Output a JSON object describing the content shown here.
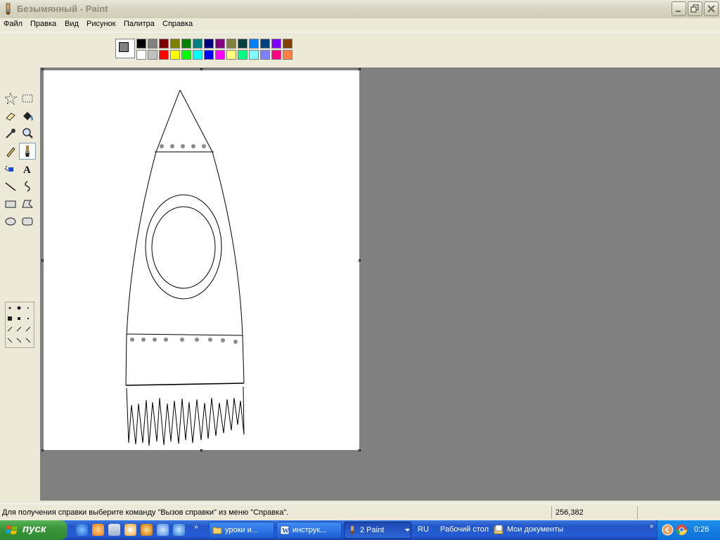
{
  "window": {
    "title": "Безымянный - Paint"
  },
  "menu": [
    "Файл",
    "Правка",
    "Вид",
    "Рисунок",
    "Палитра",
    "Справка"
  ],
  "palette": {
    "top": [
      "#000000",
      "#808080",
      "#800000",
      "#808000",
      "#008000",
      "#008080",
      "#000080",
      "#800080",
      "#808040",
      "#004040",
      "#0080ff",
      "#004080",
      "#8000ff",
      "#804000"
    ],
    "bottom": [
      "#ffffff",
      "#c0c0c0",
      "#ff0000",
      "#ffff00",
      "#00ff00",
      "#00ffff",
      "#0000ff",
      "#ff00ff",
      "#ffff80",
      "#00ff80",
      "#80ffff",
      "#8080ff",
      "#ff0080",
      "#ff8040"
    ],
    "foreground": "#808080",
    "background": "#ffffff"
  },
  "tools": [
    "free-form-select",
    "select",
    "eraser",
    "fill-with-color",
    "pick-color",
    "magnifier",
    "pencil",
    "brush",
    "airbrush",
    "text",
    "line",
    "curve",
    "rectangle",
    "polygon",
    "ellipse",
    "rounded-rectangle"
  ],
  "selected_tool": "brush",
  "status": {
    "help": "Для получения справки выберите команду \"Вызов справки\" из меню \"Справка\".",
    "coords": "256,382"
  },
  "taskbar": {
    "start_label": "пуск",
    "items": [
      {
        "label": "уроки и...",
        "icon": "folder-icon"
      },
      {
        "label": "инструк...",
        "icon": "word-icon"
      },
      {
        "label": "2 Paint",
        "icon": "paint-icon",
        "active": true
      }
    ],
    "lang": "RU",
    "desktop_label": "Рабочий стол",
    "documents_label": "Мои документы",
    "clock": "0:26"
  }
}
